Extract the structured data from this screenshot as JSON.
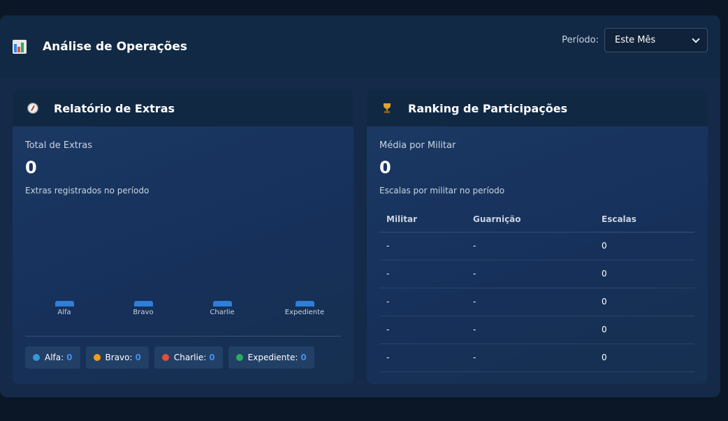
{
  "header": {
    "title": "Análise de Operações",
    "icon": "bar-chart-icon",
    "period_label": "Período:",
    "period_value": "Este Mês"
  },
  "extras": {
    "title": "Relatório de Extras",
    "icon": "compass-icon",
    "stat_label": "Total de Extras",
    "stat_value": "0",
    "stat_sub": "Extras registrados no período",
    "bars": [
      {
        "label": "Alfa",
        "value": 0
      },
      {
        "label": "Bravo",
        "value": 0
      },
      {
        "label": "Charlie",
        "value": 0
      },
      {
        "label": "Expediente",
        "value": 0
      }
    ],
    "legend": [
      {
        "label": "Alfa:",
        "value": "0",
        "color": "#3498db"
      },
      {
        "label": "Bravo:",
        "value": "0",
        "color": "#f39c12"
      },
      {
        "label": "Charlie:",
        "value": "0",
        "color": "#e74c3c"
      },
      {
        "label": "Expediente:",
        "value": "0",
        "color": "#27ae60"
      }
    ]
  },
  "ranking": {
    "title": "Ranking de Participações",
    "icon": "trophy-icon",
    "stat_label": "Média por Militar",
    "stat_value": "0",
    "stat_sub": "Escalas por militar no período",
    "columns": [
      "Militar",
      "Guarnição",
      "Escalas"
    ],
    "rows": [
      [
        "-",
        "-",
        "0"
      ],
      [
        "-",
        "-",
        "0"
      ],
      [
        "-",
        "-",
        "0"
      ],
      [
        "-",
        "-",
        "0"
      ],
      [
        "-",
        "-",
        "0"
      ]
    ]
  }
}
